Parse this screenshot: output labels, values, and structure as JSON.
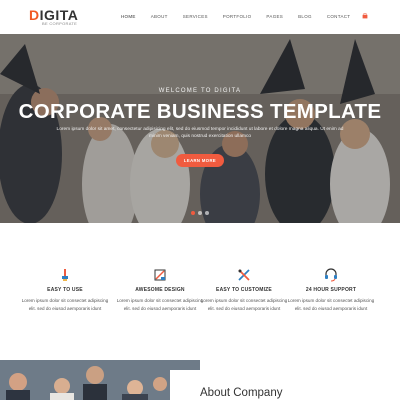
{
  "logo": {
    "main_prefix": "D",
    "main_rest": "IGITA",
    "tagline": "BE CORPORATE"
  },
  "nav": {
    "items": [
      {
        "label": "HOME"
      },
      {
        "label": "ABOUT"
      },
      {
        "label": "SERVICES"
      },
      {
        "label": "PORTFOLIO"
      },
      {
        "label": "PAGES"
      },
      {
        "label": "BLOG"
      },
      {
        "label": "CONTACT"
      }
    ],
    "cart_icon": "cart-icon"
  },
  "hero": {
    "kicker": "WELCOME TO DIGITA",
    "title": "CORPORATE BUSINESS TEMPLATE",
    "text": "Lorem ipsum dolor sit amet, consectetur adipisicing elit, sed do eiusmod tempor incididunt ut labore et dolore magna aliqua. Ut enim ad minim veniam, quis nostrud exercitation ullamco",
    "button_label": "LEARN MORE",
    "slide_count": 3,
    "active_slide": 1
  },
  "features": [
    {
      "icon": "brush-icon",
      "title": "EASY TO USE",
      "text": "Lorem ipsum dolor sit consectet adipiscing elit. sed do eiusod aemporaris idunt"
    },
    {
      "icon": "design-icon",
      "title": "AWESOME DESIGN",
      "text": "Lorem ipsum dolor sit consectet adipiscing elit. sed do eiusod aemporaris idunt"
    },
    {
      "icon": "tools-icon",
      "title": "EASY TO CUSTOMIZE",
      "text": "Lorem ipsum dolor sit consectet adipiscing elit. sed do eiusod aemporaris idunt"
    },
    {
      "icon": "headset-icon",
      "title": "24 HOUR SUPPORT",
      "text": "Lorem ipsum dolor sit consectet adipiscing elit. sed do eiusod aemporaris idunt"
    }
  ],
  "about": {
    "title": "About Company"
  },
  "colors": {
    "accent": "#f05b3f",
    "brand": "#f15a24",
    "text": "#333333"
  }
}
